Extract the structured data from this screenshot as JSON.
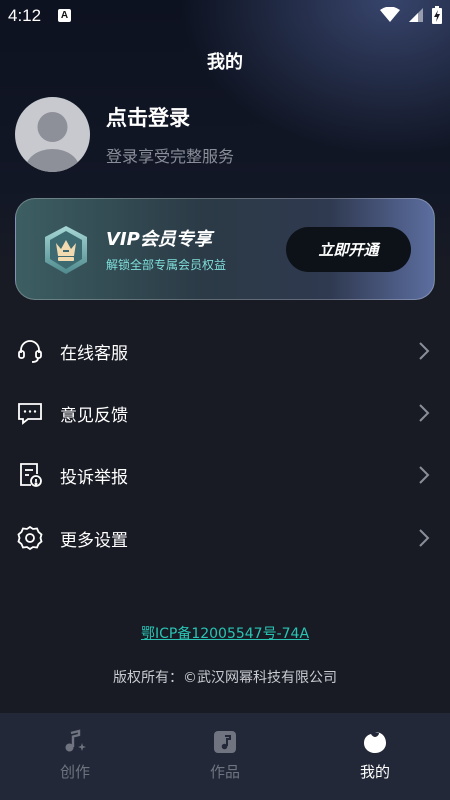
{
  "status_bar": {
    "time": "4:12",
    "badge": "A"
  },
  "header": {
    "title": "我的"
  },
  "profile": {
    "login_title": "点击登录",
    "login_subtitle": "登录享受完整服务"
  },
  "vip": {
    "title": "VIP会员专享",
    "subtitle": "解锁全部专属会员权益",
    "button_label": "立即开通",
    "accent_color": "#7fe0dc"
  },
  "menu": [
    {
      "label": "在线客服",
      "icon": "headset-icon"
    },
    {
      "label": "意见反馈",
      "icon": "feedback-chat-icon"
    },
    {
      "label": "投诉举报",
      "icon": "report-document-icon"
    },
    {
      "label": "更多设置",
      "icon": "gear-icon"
    }
  ],
  "footer": {
    "icp": "鄂ICP备12005547号-74A",
    "copyright": "版权所有：©武汉网幂科技有限公司"
  },
  "tabs": [
    {
      "label": "创作",
      "icon": "music-note-sparkle-icon",
      "active": false
    },
    {
      "label": "作品",
      "icon": "music-album-icon",
      "active": false
    },
    {
      "label": "我的",
      "icon": "profile-blob-icon",
      "active": true
    }
  ],
  "colors": {
    "background": "#181b24",
    "tabbar": "#232838",
    "link": "#29c4b4"
  }
}
